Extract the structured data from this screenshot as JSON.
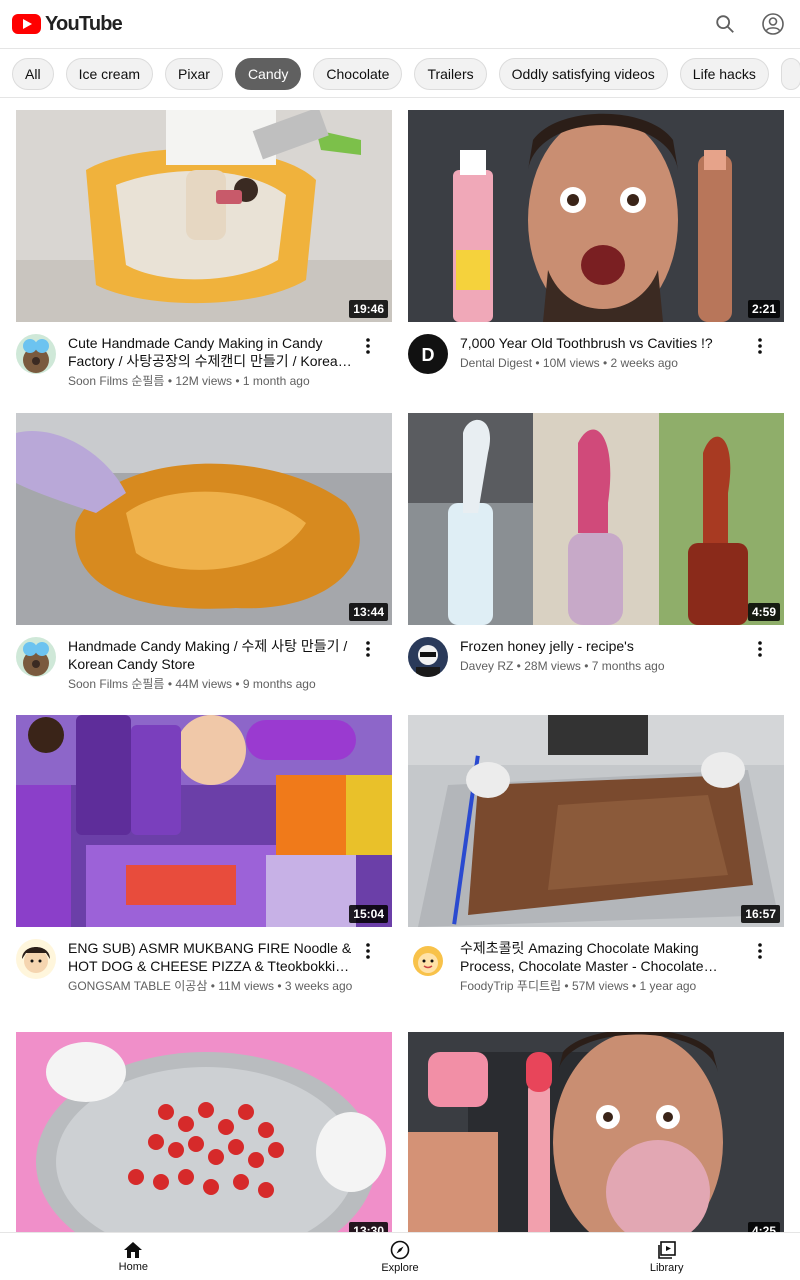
{
  "app": {
    "logo_text": "YouTube"
  },
  "chips": [
    "All",
    "Ice cream",
    "Pixar",
    "Candy",
    "Chocolate",
    "Trailers",
    "Oddly satisfying videos",
    "Life hacks"
  ],
  "active_chip": "Candy",
  "videos": [
    {
      "title": "Cute Handmade Candy Making in Candy Factory / 사탕공장의 수제캔디 만들기 / Korean Candy Store",
      "channel": "Soon Films 순필름",
      "views": "12M views",
      "age": "1 month ago",
      "duration": "19:46"
    },
    {
      "title": "7,000 Year Old Toothbrush vs Cavities !?",
      "channel": "Dental Digest",
      "views": "10M views",
      "age": "2 weeks ago",
      "duration": "2:21"
    },
    {
      "title": "Handmade Candy Making / 수제 사탕 만들기 / Korean Candy Store",
      "channel": "Soon Films 순필름",
      "views": "44M views",
      "age": "9 months ago",
      "duration": "13:44"
    },
    {
      "title": "Frozen honey jelly - recipe's",
      "channel": "Davey RZ",
      "views": "28M views",
      "age": "7 months ago",
      "duration": "4:59"
    },
    {
      "title": "ENG SUB) ASMR MUKBANG FIRE Noodle & HOT DOG & CHEESE PIZZA & Tteokbokki Purple Convenience Store Food",
      "channel": "GONGSAM TABLE 이공삼",
      "views": "11M views",
      "age": "3 weeks ago",
      "duration": "15:04"
    },
    {
      "title": "수제초콜릿 Amazing Chocolate Making Process, Chocolate Master - Chocolate Factory",
      "channel": "FoodyTrip 푸디트립",
      "views": "57M views",
      "age": "1 year ago",
      "duration": "16:57"
    },
    {
      "title": "",
      "channel": "",
      "views": "",
      "age": "",
      "duration": "13:30"
    },
    {
      "title": "",
      "channel": "",
      "views": "",
      "age": "",
      "duration": "4:25"
    }
  ],
  "bottom_nav": {
    "home": "Home",
    "explore": "Explore",
    "library": "Library"
  },
  "colors": {
    "brand_red": "#ff0000",
    "active_chip_bg": "#606060",
    "chip_bg": "#f2f2f2",
    "secondary_text": "#606060"
  },
  "icons": {
    "search": "search-icon",
    "account": "account-icon",
    "more": "more-vert-icon",
    "home": "home-icon",
    "explore": "compass-icon",
    "library": "library-icon"
  }
}
